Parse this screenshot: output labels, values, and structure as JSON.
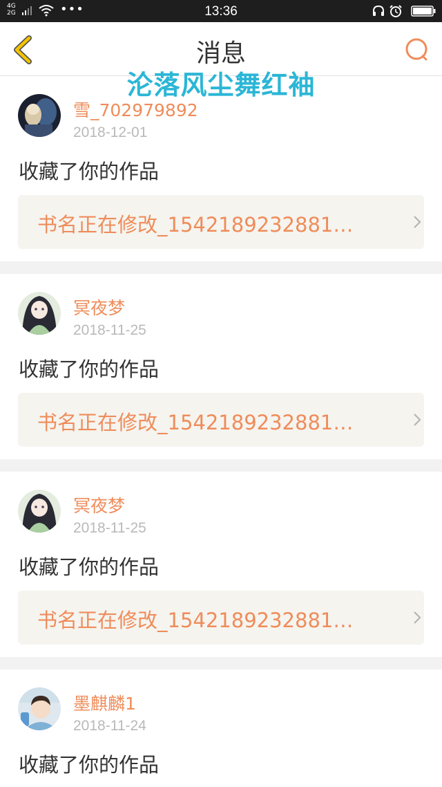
{
  "status_bar": {
    "network_top": "4G",
    "network_bottom": "2G",
    "dots": "•••",
    "time": "13:36"
  },
  "header": {
    "title": "消息",
    "back_icon": "chevron-left-icon",
    "search_icon": "search-icon"
  },
  "watermark": "沦落风尘舞红袖",
  "colors": {
    "accent": "#ef8c5a",
    "back_icon": "#f4c400",
    "watermark": "#2bb6d6",
    "card_bg": "#f5f4ef",
    "separator": "#f2f2f2"
  },
  "messages": [
    {
      "user": "雪_702979892",
      "date": "2018-12-01",
      "action": "收藏了你的作品",
      "work_title": "书名正在修改_1542189232881…",
      "avatar": "avatar-dark-fantasy"
    },
    {
      "user": "冥夜梦",
      "date": "2018-11-25",
      "action": "收藏了你的作品",
      "work_title": "书名正在修改_1542189232881…",
      "avatar": "avatar-anime-girl"
    },
    {
      "user": "冥夜梦",
      "date": "2018-11-25",
      "action": "收藏了你的作品",
      "work_title": "书名正在修改_1542189232881…",
      "avatar": "avatar-anime-girl"
    },
    {
      "user": "墨麒麟1",
      "date": "2018-11-24",
      "action": "收藏了你的作品",
      "avatar": "avatar-child-photo"
    }
  ]
}
